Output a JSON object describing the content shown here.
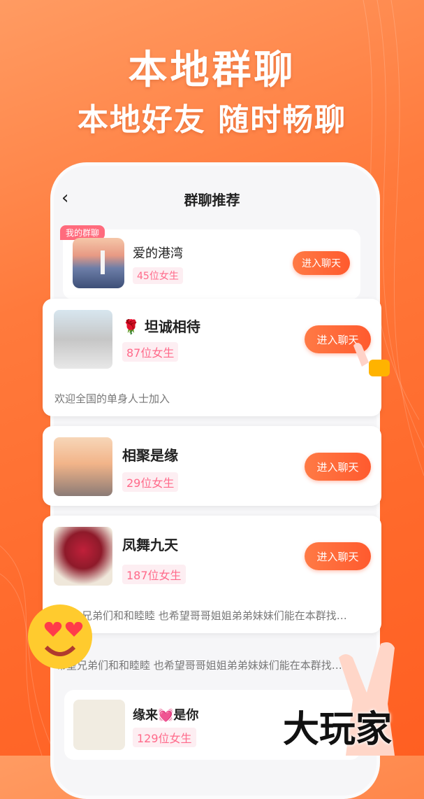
{
  "headline": "本地群聊",
  "subline": "本地好友  随时畅聊",
  "nav": {
    "title": "群聊推荐",
    "back_icon": "‹"
  },
  "my_group": {
    "tag": "我的群聊",
    "name": "爱的港湾",
    "count": "45位女生",
    "button": "进入聊天"
  },
  "groups": [
    {
      "name": "🌹 坦诚相待",
      "count": "87位女生",
      "desc": "欢迎全国的单身人士加入",
      "button": "进入聊天"
    },
    {
      "name": "相聚是缘",
      "count": "29位女生",
      "button": "进入聊天"
    },
    {
      "name": "凤舞九天",
      "count": "187位女生",
      "desc": "兄弟们和和睦睦 也希望哥哥姐姐弟弟妹妹们能在本群找…",
      "button": "进入聊天"
    }
  ],
  "faded_desc": "希望兄弟们和和睦睦 也希望哥哥姐姐弟弟妹妹们能在本群找…",
  "bottom_group": {
    "name": "缘来💓是你",
    "count": "129位女生"
  },
  "watermark": "大玩家"
}
